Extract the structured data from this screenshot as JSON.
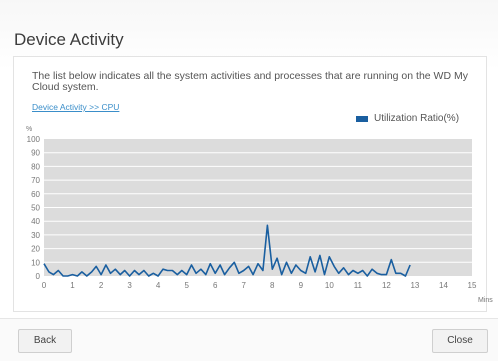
{
  "dialog": {
    "title": "Device Activity",
    "description": "The list below indicates all the system activities and processes that are running on the WD My Cloud system.",
    "breadcrumb": "Device Activity >> CPU",
    "legend_label": "Utilization Ratio(%)",
    "back_label": "Back",
    "close_label": "Close"
  },
  "colors": {
    "series": "#1a5fa0",
    "plot_bg": "#dcdcdc",
    "grid": "#ffffff",
    "link": "#3a8ec9"
  },
  "chart_data": {
    "type": "line",
    "ylabel": "%",
    "xlabel": "Mins",
    "ylim": [
      0,
      100
    ],
    "xlim": [
      0,
      15
    ],
    "y_ticks": [
      "0",
      "10",
      "20",
      "30",
      "40",
      "50",
      "60",
      "70",
      "80",
      "90",
      "100"
    ],
    "x_ticks": [
      "0",
      "1",
      "2",
      "3",
      "4",
      "5",
      "6",
      "7",
      "8",
      "9",
      "10",
      "11",
      "12",
      "13",
      "14",
      "15"
    ],
    "grid": true,
    "legend": "top-right",
    "series": [
      {
        "name": "Utilization Ratio(%)",
        "x": [
          0,
          0.17,
          0.33,
          0.5,
          0.67,
          0.83,
          1.0,
          1.17,
          1.33,
          1.5,
          1.67,
          1.83,
          2.0,
          2.17,
          2.33,
          2.5,
          2.67,
          2.83,
          3.0,
          3.17,
          3.33,
          3.5,
          3.67,
          3.83,
          4.0,
          4.17,
          4.33,
          4.5,
          4.67,
          4.83,
          5.0,
          5.17,
          5.33,
          5.5,
          5.67,
          5.83,
          6.0,
          6.17,
          6.33,
          6.5,
          6.67,
          6.83,
          7.0,
          7.17,
          7.33,
          7.5,
          7.67,
          7.83,
          8.0,
          8.17,
          8.33,
          8.5,
          8.67,
          8.83,
          9.0,
          9.17,
          9.33,
          9.5,
          9.67,
          9.83,
          10.0,
          10.17,
          10.33,
          10.5,
          10.67,
          10.83,
          11.0,
          11.17,
          11.33,
          11.5,
          11.67,
          11.83,
          12.0,
          12.17,
          12.33,
          12.5,
          12.67,
          12.83
        ],
        "values": [
          9,
          3,
          1,
          4,
          0,
          0,
          1,
          0,
          3,
          0,
          3,
          7,
          1,
          8,
          2,
          5,
          1,
          4,
          0,
          4,
          1,
          4,
          0,
          2,
          0,
          5,
          4,
          4,
          1,
          4,
          1,
          8,
          2,
          5,
          1,
          9,
          2,
          8,
          1,
          6,
          10,
          2,
          4,
          7,
          1,
          9,
          4,
          37,
          5,
          13,
          1,
          10,
          2,
          8,
          4,
          2,
          14,
          3,
          15,
          1,
          14,
          7,
          2,
          6,
          1,
          4,
          2,
          4,
          0,
          5,
          2,
          1,
          1,
          12,
          2,
          2,
          0,
          8
        ]
      }
    ]
  }
}
